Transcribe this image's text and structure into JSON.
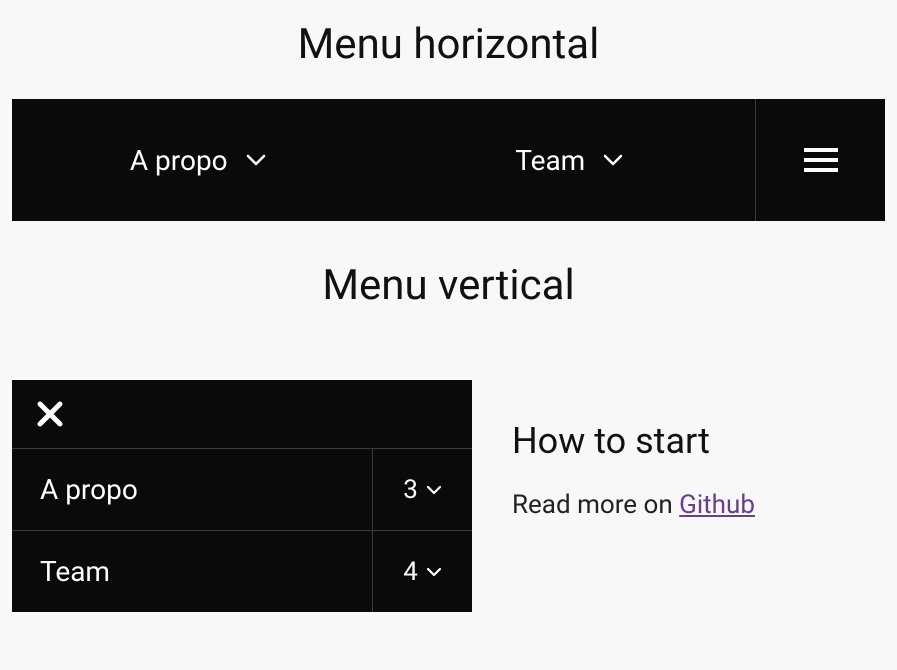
{
  "headings": {
    "horizontal": "Menu horizontal",
    "vertical": "Menu vertical"
  },
  "horizontal_menu": {
    "items": [
      {
        "label": "A propo"
      },
      {
        "label": "Team"
      }
    ]
  },
  "vertical_menu": {
    "items": [
      {
        "label": "A propo",
        "count": "3"
      },
      {
        "label": "Team",
        "count": "4"
      }
    ]
  },
  "side": {
    "heading": "How to start",
    "text_prefix": "Read more on ",
    "link_label": "Github"
  }
}
